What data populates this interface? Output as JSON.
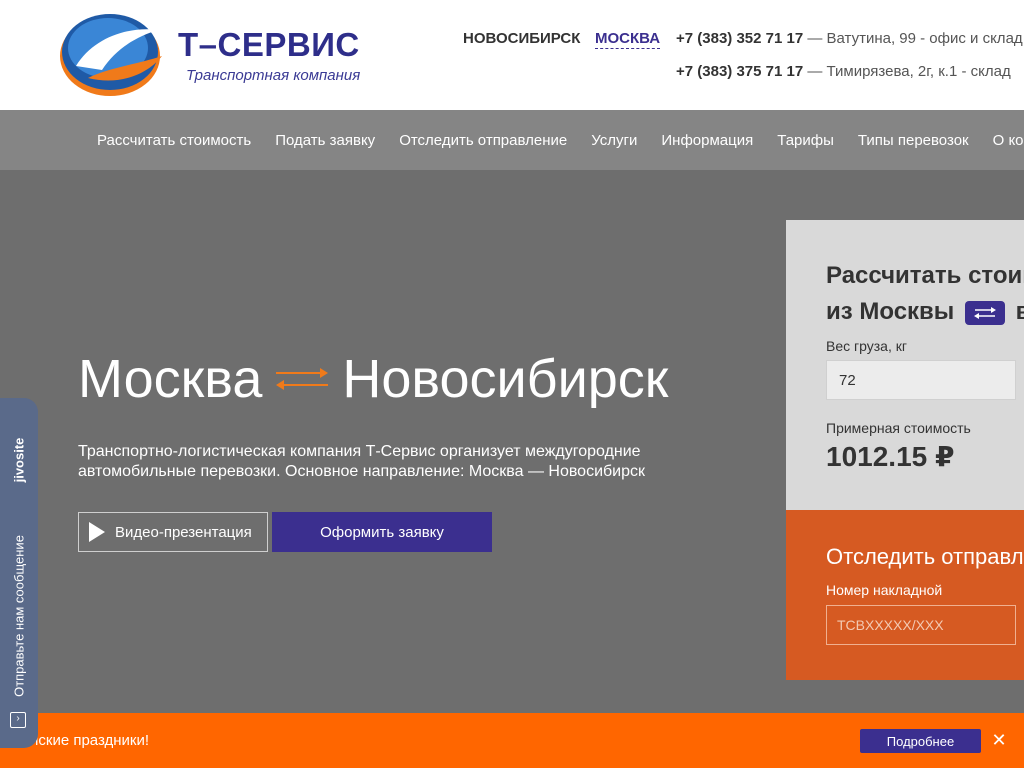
{
  "header": {
    "logo_title": "Т–СЕРВИС",
    "logo_subtitle": "Транспортная компания",
    "city_novosibirsk": "НОВОСИБИРСК",
    "city_moscow": "МОСКВА",
    "phone_1": "+7 (383) 352 71 17",
    "address_1": " — Ватутина, 99 - офис и склад",
    "phone_2": "+7 (383) 375 71 17",
    "address_2": " — Тимирязева, 2г, к.1 - склад"
  },
  "nav": {
    "items": [
      "Рассчитать стоимость",
      "Подать заявку",
      "Отследить отправление",
      "Услуги",
      "Информация",
      "Тарифы",
      "Типы перевозок",
      "О компании"
    ]
  },
  "hero": {
    "city_from": "Москва",
    "city_to": "Новосибирск",
    "description": "Транспортно-логистическая компания Т-Сервис организует междугородние автомобильные перевозки. Основное направление: Москва — Новосибирск",
    "video_button": "Видео-презентация",
    "order_button": "Оформить заявку"
  },
  "calculator": {
    "title_line1": "Рассчитать стоимость",
    "title_line2_prefix": "из Москвы",
    "title_line2_suffix": "в",
    "weight_label": "Вес груза, кг",
    "weight_value": "72",
    "cost_label": "Примерная стоимость",
    "cost_value": "1012.15 ₽"
  },
  "tracking": {
    "title": "Отследить отправление",
    "label": "Номер накладной",
    "placeholder": "ТСВXXXXX/XXX"
  },
  "banner": {
    "text": "йские праздники!",
    "button": "Подробнее",
    "close": "✕"
  },
  "jivosite": {
    "brand": "jivosite",
    "text": "Отправьте нам сообщение"
  },
  "colors": {
    "brand_purple": "#3b2f8f",
    "banner_orange": "#ff6600",
    "track_orange": "#d65a22",
    "nav_gray": "#858585",
    "hero_gray": "#6e6e6e"
  }
}
